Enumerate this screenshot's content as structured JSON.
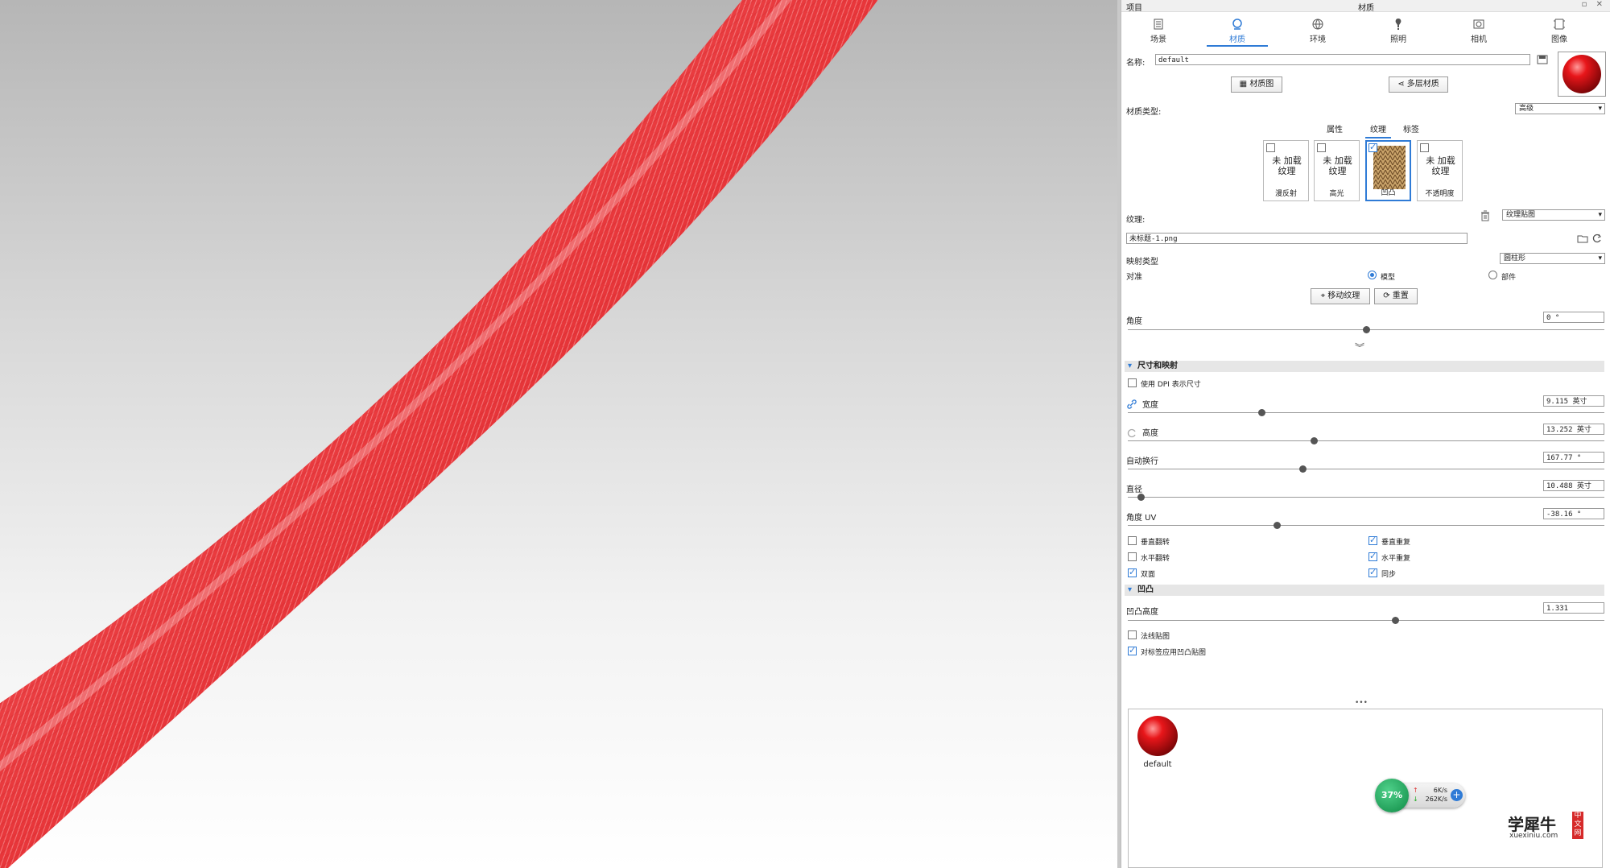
{
  "panel": {
    "topbar": {
      "left": "项目",
      "title": "材质",
      "controls": "▫ ✕"
    },
    "tabs": [
      {
        "label": "场景",
        "icon": "scene-icon"
      },
      {
        "label": "材质",
        "icon": "material-icon",
        "active": true
      },
      {
        "label": "环境",
        "icon": "environment-icon"
      },
      {
        "label": "照明",
        "icon": "lighting-icon"
      },
      {
        "label": "相机",
        "icon": "camera-icon"
      },
      {
        "label": "图像",
        "icon": "image-icon"
      }
    ],
    "name_label": "名称:",
    "name_value": "default",
    "material_graph_btn": "材质图",
    "multi_material_btn": "多层材质",
    "material_type_label": "材质类型:",
    "material_type_value": "高级",
    "subtabs": [
      "属性",
      "纹理",
      "标签"
    ],
    "active_subtab": "纹理",
    "slots": [
      {
        "empty_text": "未 加载 纹理",
        "caption": "漫反射",
        "checked": false
      },
      {
        "empty_text": "未 加载 纹理",
        "caption": "高光",
        "checked": false
      },
      {
        "empty_text": "",
        "caption": "凹凸",
        "checked": true
      },
      {
        "empty_text": "未 加载 纹理",
        "caption": "不透明度",
        "checked": false
      }
    ],
    "texture_label": "纹理:",
    "texture_type": "纹理贴图",
    "texture_file": "未标题-1.png",
    "mapping_label": "映射类型",
    "mapping_value": "圆柱形",
    "align_label": "对准",
    "align_options": [
      "模型",
      "部件"
    ],
    "align_selected": "模型",
    "move_texture_btn": "移动纹理",
    "reset_btn": "重置",
    "angle_label": "角度",
    "angle_value": "0 °",
    "angle_slider": 0.5,
    "section_size": "尺寸和映射",
    "use_dpi": "使用 DPI 表示尺寸",
    "width_label": "宽度",
    "width_value": "9.115 英寸",
    "width_slider": 0.28,
    "height_label": "高度",
    "height_value": "13.252 英寸",
    "height_slider": 0.39,
    "auto_wrap_label": "自动换行",
    "auto_wrap_value": "167.77 °",
    "auto_wrap_slider": 0.366,
    "diameter_label": "直径",
    "diameter_value": "10.488 英寸",
    "diameter_slider": 0.027,
    "angle_uv_label": "角度 UV",
    "angle_uv_value": "-38.16 °",
    "angle_uv_slider": 0.312,
    "checks_left": [
      {
        "label": "垂直翻转",
        "checked": false
      },
      {
        "label": "水平翻转",
        "checked": false
      },
      {
        "label": "双面",
        "checked": true
      }
    ],
    "checks_right": [
      {
        "label": "垂直重复",
        "checked": true
      },
      {
        "label": "水平重复",
        "checked": true
      },
      {
        "label": "同步",
        "checked": true
      }
    ],
    "section_bump": "凹凸",
    "bump_height_label": "凹凸高度",
    "bump_height_value": "1.331",
    "bump_slider": 0.56,
    "normal_map": {
      "label": "法线贴图",
      "checked": false
    },
    "apply_label_bump": {
      "label": "对标签应用凹凸贴图",
      "checked": true
    },
    "ellipsis": "•••",
    "preview_material_name": "default"
  },
  "widget": {
    "percent": "37%",
    "up": "6K/s",
    "down": "262K/s"
  },
  "watermark": {
    "text": "学犀牛",
    "sub": "xuexiniu.com",
    "badge": "中文网"
  },
  "colors": {
    "accent": "#2f7bd6",
    "rope_red": "#e8363a"
  }
}
